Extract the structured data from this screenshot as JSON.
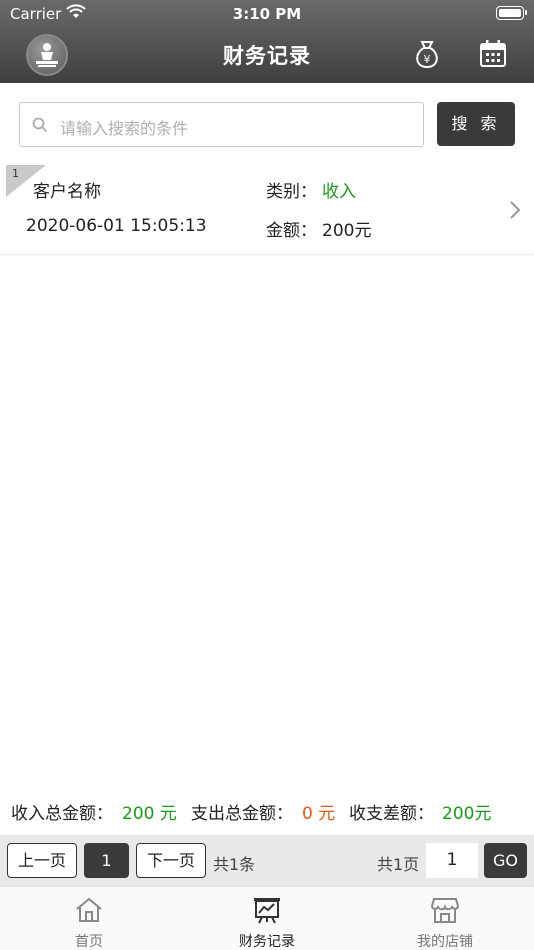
{
  "status_bar": {
    "carrier": "Carrier",
    "time": "3:10 PM"
  },
  "header": {
    "title": "财务记录",
    "left_icon": "massage-avatar-icon",
    "right_icons": [
      "money-bag-icon",
      "calendar-icon"
    ]
  },
  "search": {
    "placeholder": "请输入搜索的条件",
    "button_label": "搜 索"
  },
  "records": [
    {
      "index": "1",
      "customer": "客户名称",
      "category_label": "类别：",
      "category": "收入",
      "datetime": "2020-06-01 15:05:13",
      "amount_label": "金额：",
      "amount": "200元"
    }
  ],
  "summary": {
    "income_label": "收入总金额：",
    "income_value": "200 元",
    "expense_label": "支出总金额：",
    "expense_value": "0 元",
    "diff_label": "收支差额：",
    "diff_value": "200元"
  },
  "pager": {
    "prev_label": "上一页",
    "current_page": "1",
    "next_label": "下一页",
    "total_items": "共1条",
    "total_pages": "共1页",
    "goto_value": "1",
    "go_label": "GO"
  },
  "tabs": [
    {
      "label": "首页",
      "icon": "home-icon"
    },
    {
      "label": "财务记录",
      "icon": "chart-board-icon",
      "active": true
    },
    {
      "label": "我的店铺",
      "icon": "store-icon"
    }
  ],
  "colors": {
    "header_bg": "#4a4a4a",
    "income_green": "#1a9a1a",
    "expense_orange": "#e05a10",
    "button_dark": "#3a3a3a"
  }
}
